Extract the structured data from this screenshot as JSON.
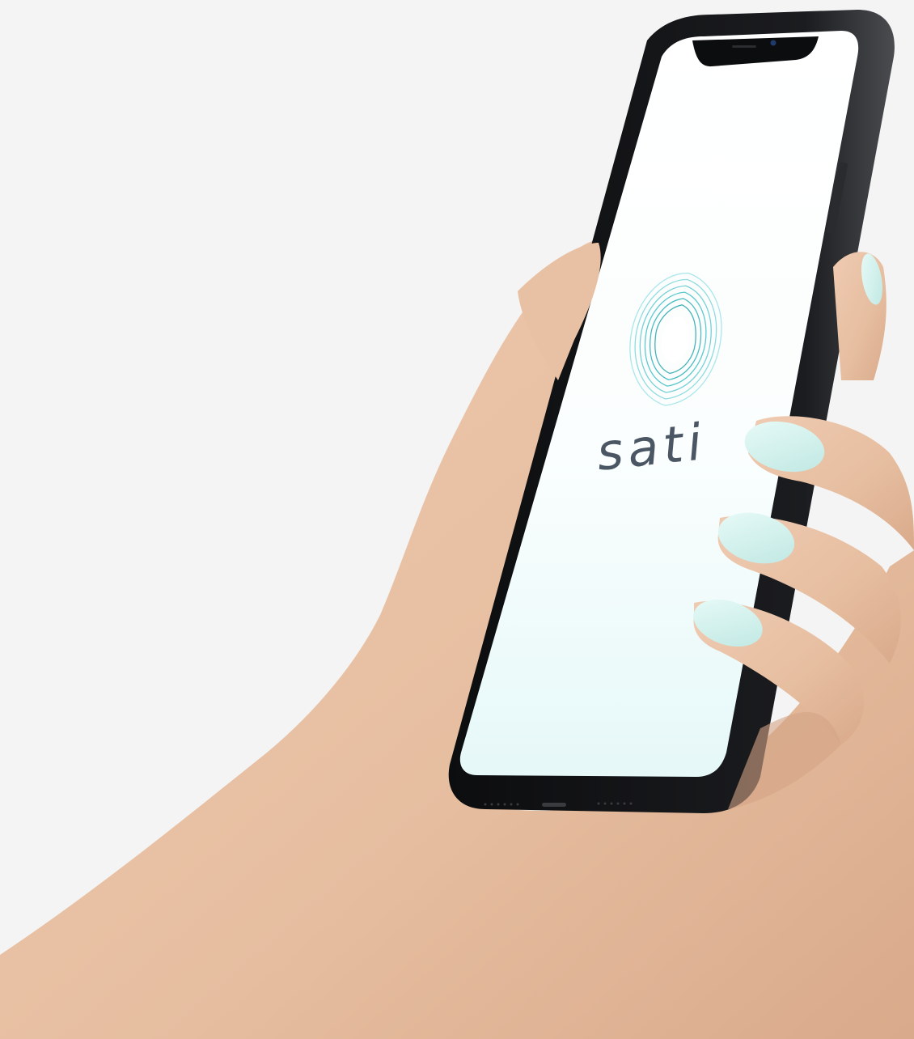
{
  "app": {
    "name": "sati",
    "logo_icon": "sati-wave-ring-icon"
  },
  "colors": {
    "background": "#f4f4f4",
    "phone_body": "#111214",
    "screen_top": "#ffffff",
    "screen_bottom": "#e6f8f8",
    "logo_teal": "#5cc9cf",
    "logo_light": "#a9e6ea",
    "wordmark": "#4a5663",
    "skin": "#e9c2a6",
    "skin_shadow": "#d7a688",
    "nail": "#d6f1ee"
  }
}
